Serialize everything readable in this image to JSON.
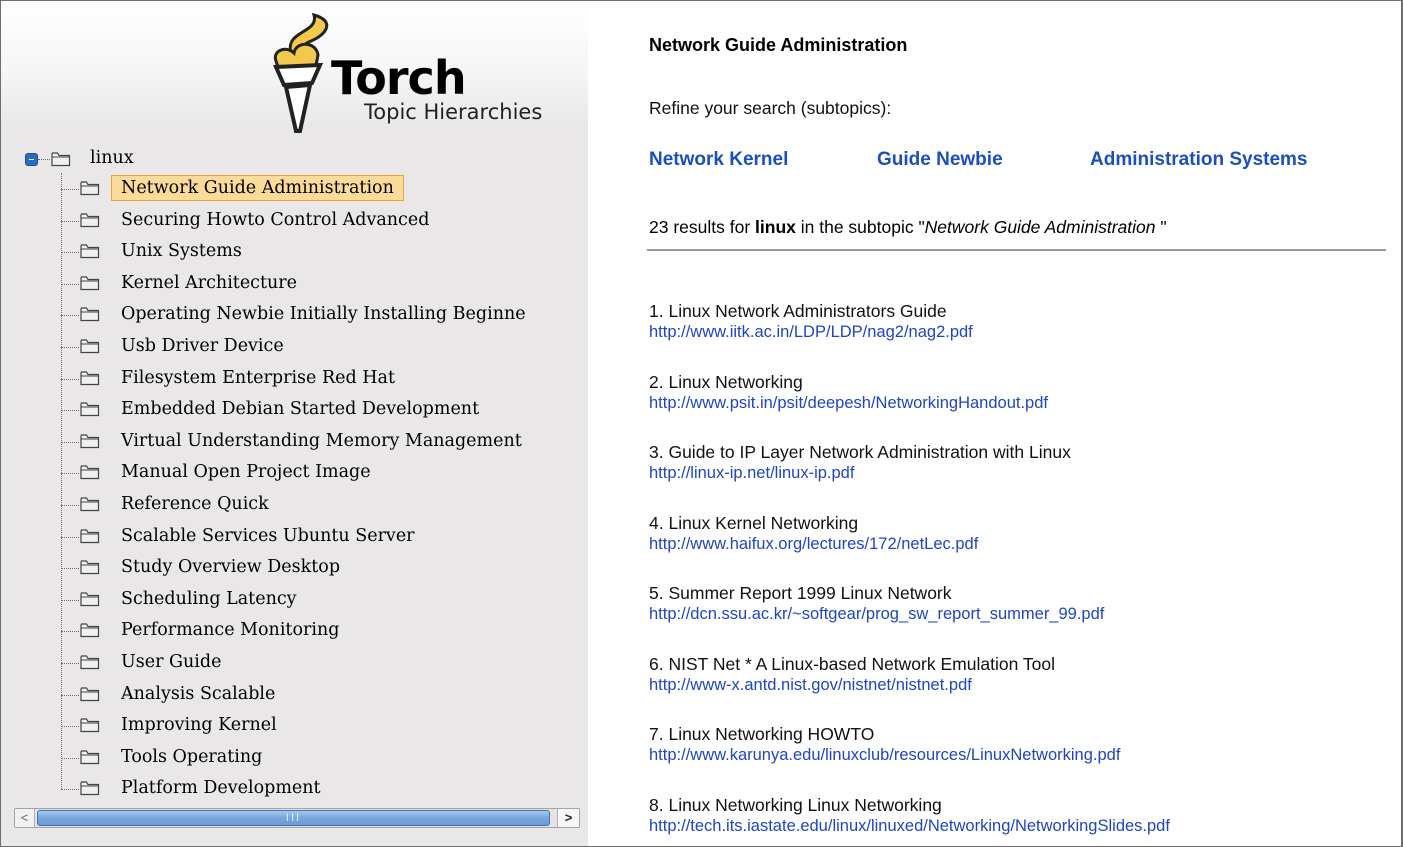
{
  "brand": {
    "name": "Torch",
    "subtitle": "Topic Hierarchies"
  },
  "tree": {
    "root": "linux",
    "items": [
      "Network Guide Administration",
      "Securing Howto Control Advanced",
      "Unix Systems",
      "Kernel Architecture",
      "Operating Newbie Initially Installing Beginne",
      "Usb Driver Device",
      "Filesystem Enterprise Red Hat",
      "Embedded Debian Started Development",
      "Virtual Understanding Memory Management",
      "Manual Open Project Image",
      "Reference Quick",
      "Scalable Services Ubuntu Server",
      "Study Overview Desktop",
      "Scheduling Latency",
      "Performance Monitoring",
      "User Guide",
      "Analysis Scalable",
      "Improving Kernel",
      "Tools Operating",
      "Platform Development"
    ],
    "selected": "Network Guide Administration",
    "scrollbar_grip": "III",
    "scroll_left_glyph": "<",
    "scroll_right_glyph": ">"
  },
  "main": {
    "title": "Network Guide Administration",
    "refine_label": "Refine your search (subtopics):",
    "subtopics": [
      "Network Kernel",
      "Guide Newbie",
      "Administration Systems"
    ],
    "summary": {
      "prefix": "23 results for ",
      "query": "linux",
      "middle": " in the subtopic \"",
      "subtopic": "Network Guide Administration",
      "suffix": " \""
    },
    "results": [
      {
        "title": "1. Linux Network Administrators Guide",
        "url": "http://www.iitk.ac.in/LDP/LDP/nag2/nag2.pdf"
      },
      {
        "title": "2. Linux Networking",
        "url": "http://www.psit.in/psit/deepesh/NetworkingHandout.pdf"
      },
      {
        "title": "3. Guide to IP Layer Network Administration with Linux",
        "url": "http://linux-ip.net/linux-ip.pdf"
      },
      {
        "title": "4. Linux Kernel Networking",
        "url": "http://www.haifux.org/lectures/172/netLec.pdf"
      },
      {
        "title": "5. Summer Report 1999 Linux Network",
        "url": "http://dcn.ssu.ac.kr/~softgear/prog_sw_report_summer_99.pdf"
      },
      {
        "title": "6. NIST Net * A Linux-based Network Emulation Tool",
        "url": "http://www-x.antd.nist.gov/nistnet/nistnet.pdf"
      },
      {
        "title": "7. Linux Networking HOWTO",
        "url": "http://www.karunya.edu/linuxclub/resources/LinuxNetworking.pdf"
      },
      {
        "title": "8. Linux Networking Linux Networking",
        "url": "http://tech.its.iastate.edu/linux/linuxed/Networking/NetworkingSlides.pdf"
      }
    ]
  },
  "colors": {
    "link": "#1f45c0",
    "subtopic_link": "#1a4fbd",
    "selected_bg": "#fbdb99",
    "selected_border": "#e5a638",
    "sidebar_bg": "#e9e7e7",
    "scroll_thumb": "#78a5dd"
  },
  "icons": {
    "logo": "torch-icon",
    "tree_toggle": "collapse-icon",
    "tree_node": "folder-icon"
  }
}
